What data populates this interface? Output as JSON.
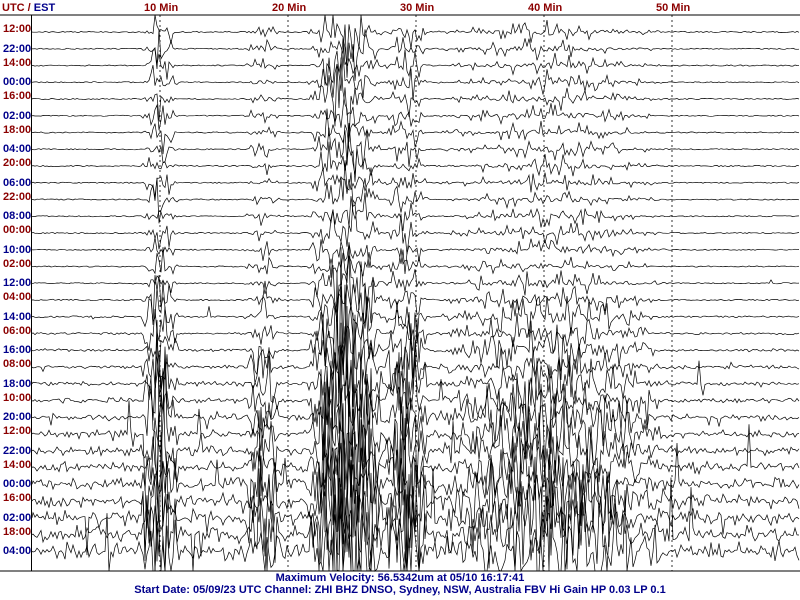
{
  "header": {
    "tz_utc": "UTC",
    "tz_sep": " / ",
    "tz_est": "EST",
    "ticks": [
      "10 Min",
      "20 Min",
      "30 Min",
      "40 Min",
      "50 Min"
    ]
  },
  "colors": {
    "utc": "#8b0000",
    "est": "#00008b",
    "header": "#8b0000",
    "footer": "#00008b",
    "trace": "#000000",
    "gridline": "#000000"
  },
  "rows": {
    "utc": [
      "12:00",
      "14:00",
      "16:00",
      "18:00",
      "20:00",
      "22:00",
      "00:00",
      "02:00",
      "04:00",
      "06:00",
      "08:00",
      "10:00",
      "12:00",
      "14:00",
      "16:00",
      "18:00"
    ],
    "est": [
      "22:00",
      "00:00",
      "02:00",
      "04:00",
      "06:00",
      "08:00",
      "10:00",
      "12:00",
      "14:00",
      "16:00",
      "18:00",
      "20:00",
      "22:00",
      "00:00",
      "02:00",
      "04:00"
    ]
  },
  "footer": {
    "line1": "Maximum Velocity: 56.5342um at 05/10 16:17:41",
    "line2": "Start Date: 05/09/23 UTC Channel: ZHI  BHZ  DNSO, Sydney, NSW, Australia  FBV Hi Gain HP 0.03  LP 0.1"
  },
  "chart_data": {
    "type": "seismogram",
    "title": "",
    "x_unit_label": "Min",
    "x_ticks": [
      10,
      20,
      30,
      40,
      50
    ],
    "xlim": [
      0,
      60
    ],
    "trace_lines": 32,
    "minutes_per_line": 60,
    "gridlines": "vertical dashed at each 10 Min",
    "max_velocity_um": 56.5342,
    "max_velocity_time": "05/10 16:17:41",
    "start_date": "05/09/23",
    "channel": "ZHI BHZ",
    "station": "DNSO, Sydney, NSW, Australia",
    "filter": "FBV Hi Gain HP 0.03 LP 0.1",
    "activity_bursts": [
      {
        "start_min": 8.5,
        "end_min": 11.5,
        "level": "strong"
      },
      {
        "start_min": 16.5,
        "end_min": 19.5,
        "level": "moderate"
      },
      {
        "start_min": 21.5,
        "end_min": 27.5,
        "level": "very strong"
      },
      {
        "start_min": 27.5,
        "end_min": 31,
        "level": "strong"
      },
      {
        "start_min": 31,
        "end_min": 50,
        "level": "moderate"
      }
    ]
  }
}
